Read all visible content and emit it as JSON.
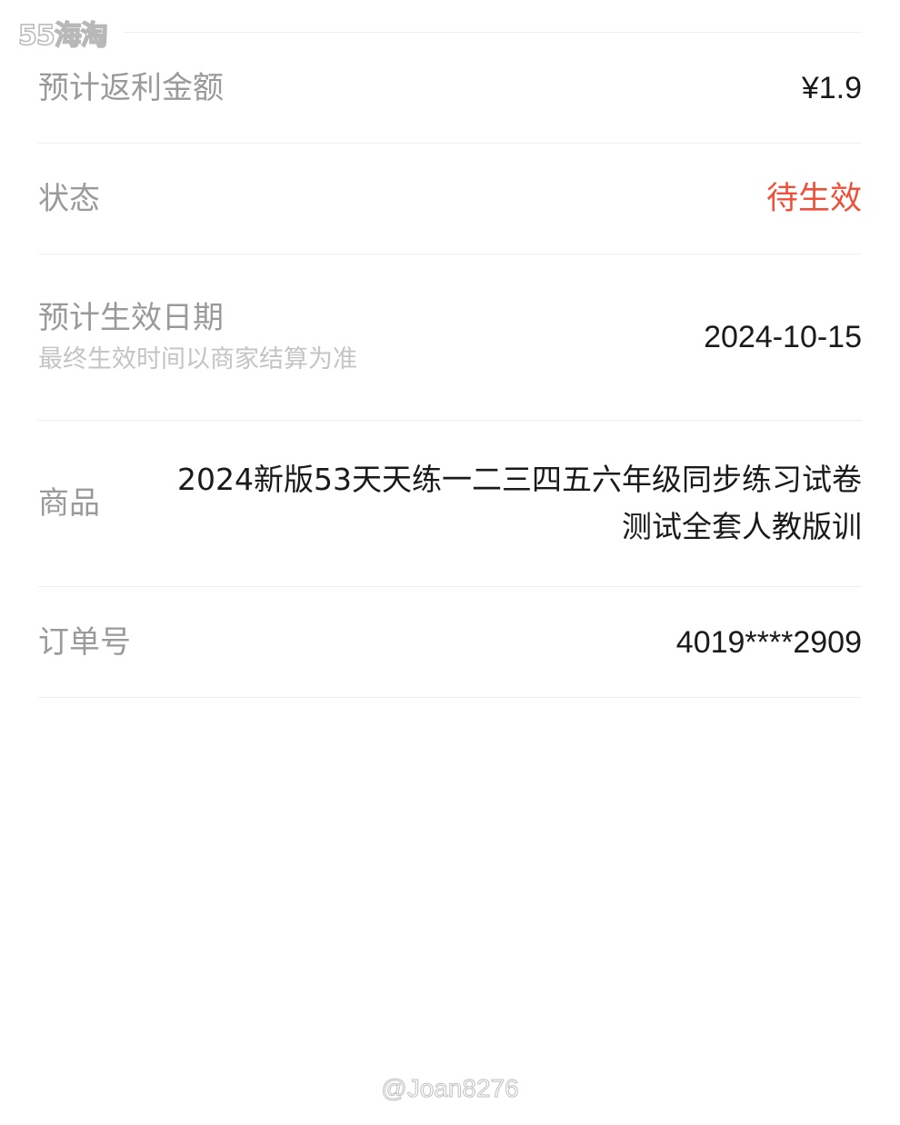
{
  "watermark": {
    "top": "55海淘",
    "bottom": "@Joan8276"
  },
  "rows": [
    {
      "label": "预计返利金额",
      "value": "¥1.9"
    },
    {
      "label": "状态",
      "value": "待生效",
      "value_color": "#f0503a"
    },
    {
      "label": "预计生效日期",
      "sublabel": "最终生效时间以商家结算为准",
      "value": "2024-10-15"
    },
    {
      "label": "商品",
      "value": "2024新版53天天练一二三四五六年级同步练习试卷测试全套人教版训"
    },
    {
      "label": "订单号",
      "value": "4019****2909"
    }
  ]
}
